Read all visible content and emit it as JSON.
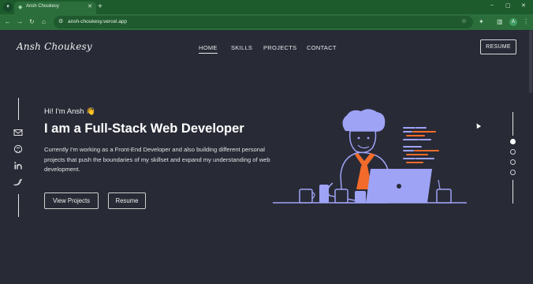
{
  "browser": {
    "tab_title": "Ansh Choukesy",
    "url": "ansh-choukesy.vercel.app",
    "new_tab": "+",
    "profile_initial": "A",
    "window_controls": [
      "–",
      "▢",
      "✕"
    ]
  },
  "site": {
    "logo": "Ansh Choukesy",
    "nav": [
      "HOME",
      "SKILLS",
      "PROJECTS",
      "CONTACT"
    ],
    "resume_button": "RESUME"
  },
  "hero": {
    "greeting": "Hi! I'm Ansh 👋",
    "headline": "I am a Full-Stack Web Developer",
    "description": "Currently I'm working as a Front-End Developer and also building different personal projects that push the boundaries of my skillset and expand my understanding of web development.",
    "primary_button": "View Projects",
    "secondary_button": "Resume"
  },
  "social_icons": [
    "mail-icon",
    "github-icon",
    "linkedin-icon",
    "twitter-icon"
  ],
  "section_dots": {
    "count": 4,
    "active_index": 0
  },
  "colors": {
    "page_bg": "#282a36",
    "accent_orange": "#f26b2a",
    "illustration_purple": "#9fa3f5",
    "browser_green": "#2b6e3b"
  }
}
